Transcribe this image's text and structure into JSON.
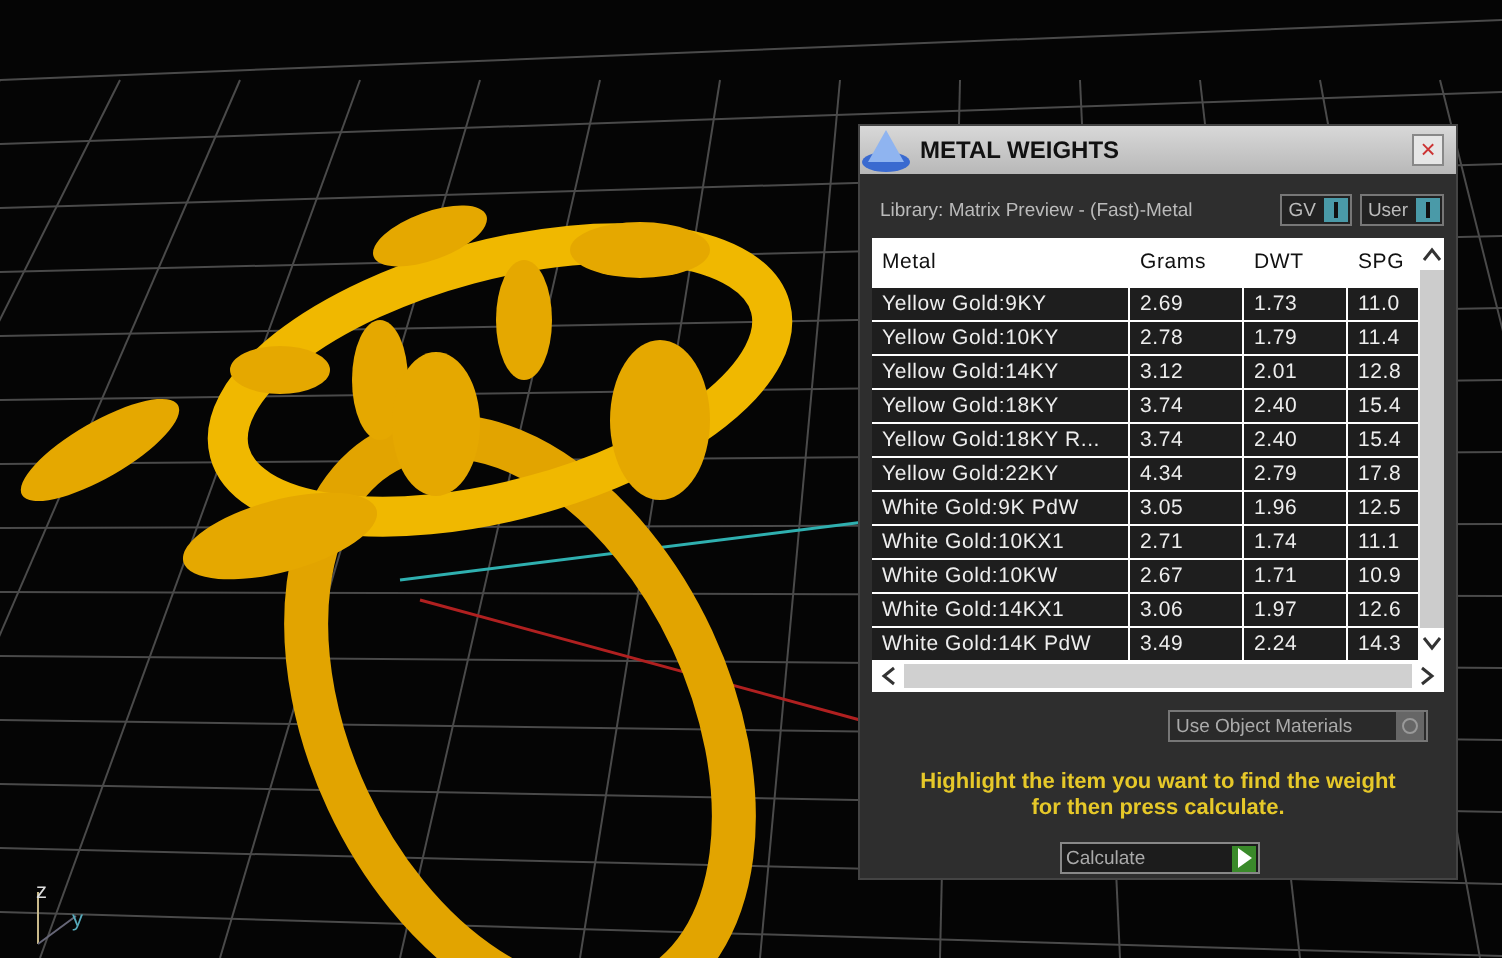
{
  "viewport": {
    "axis_labels": [
      "z",
      "y"
    ]
  },
  "dialog": {
    "title": "METAL WEIGHTS",
    "close": "×",
    "library": "Library: Matrix Preview - (Fast)-Metal",
    "toggles": [
      {
        "label": "GV",
        "on": true
      },
      {
        "label": "User",
        "on": true
      }
    ],
    "table": {
      "columns": [
        "Metal",
        "Grams",
        "DWT",
        "SPG"
      ],
      "rows": [
        {
          "cells": [
            "Yellow Gold:9KY",
            "2.69",
            "1.73",
            "11.0"
          ],
          "selected": false
        },
        {
          "cells": [
            "Yellow Gold:10KY",
            "2.78",
            "1.79",
            "11.4"
          ],
          "selected": false
        },
        {
          "cells": [
            "Yellow Gold:14KY",
            "3.12",
            "2.01",
            "12.8"
          ],
          "selected": false
        },
        {
          "cells": [
            "Yellow Gold:18KY",
            "3.74",
            "2.40",
            "15.4"
          ],
          "selected": false
        },
        {
          "cells": [
            "Yellow Gold:18KY R...",
            "3.74",
            "2.40",
            "15.4"
          ],
          "selected": false
        },
        {
          "cells": [
            "Yellow Gold:22KY",
            "4.34",
            "2.79",
            "17.8"
          ],
          "selected": false
        },
        {
          "cells": [
            "White Gold:9K PdW",
            "3.05",
            "1.96",
            "12.5"
          ],
          "selected": false
        },
        {
          "cells": [
            "White Gold:10KX1",
            "2.71",
            "1.74",
            "11.1"
          ],
          "selected": false
        },
        {
          "cells": [
            "White Gold:10KW",
            "2.67",
            "1.71",
            "10.9"
          ],
          "selected": false
        },
        {
          "cells": [
            "White Gold:14KX1",
            "3.06",
            "1.97",
            "12.6"
          ],
          "selected": false
        },
        {
          "cells": [
            "White Gold:14K PdW",
            "3.49",
            "2.24",
            "14.3"
          ],
          "selected": false
        }
      ]
    },
    "use_object_materials": {
      "label": "Use Object Materials",
      "on": false
    },
    "hint": "Highlight the item you want to find the weight for then press calculate.",
    "calculate": "Calculate"
  }
}
